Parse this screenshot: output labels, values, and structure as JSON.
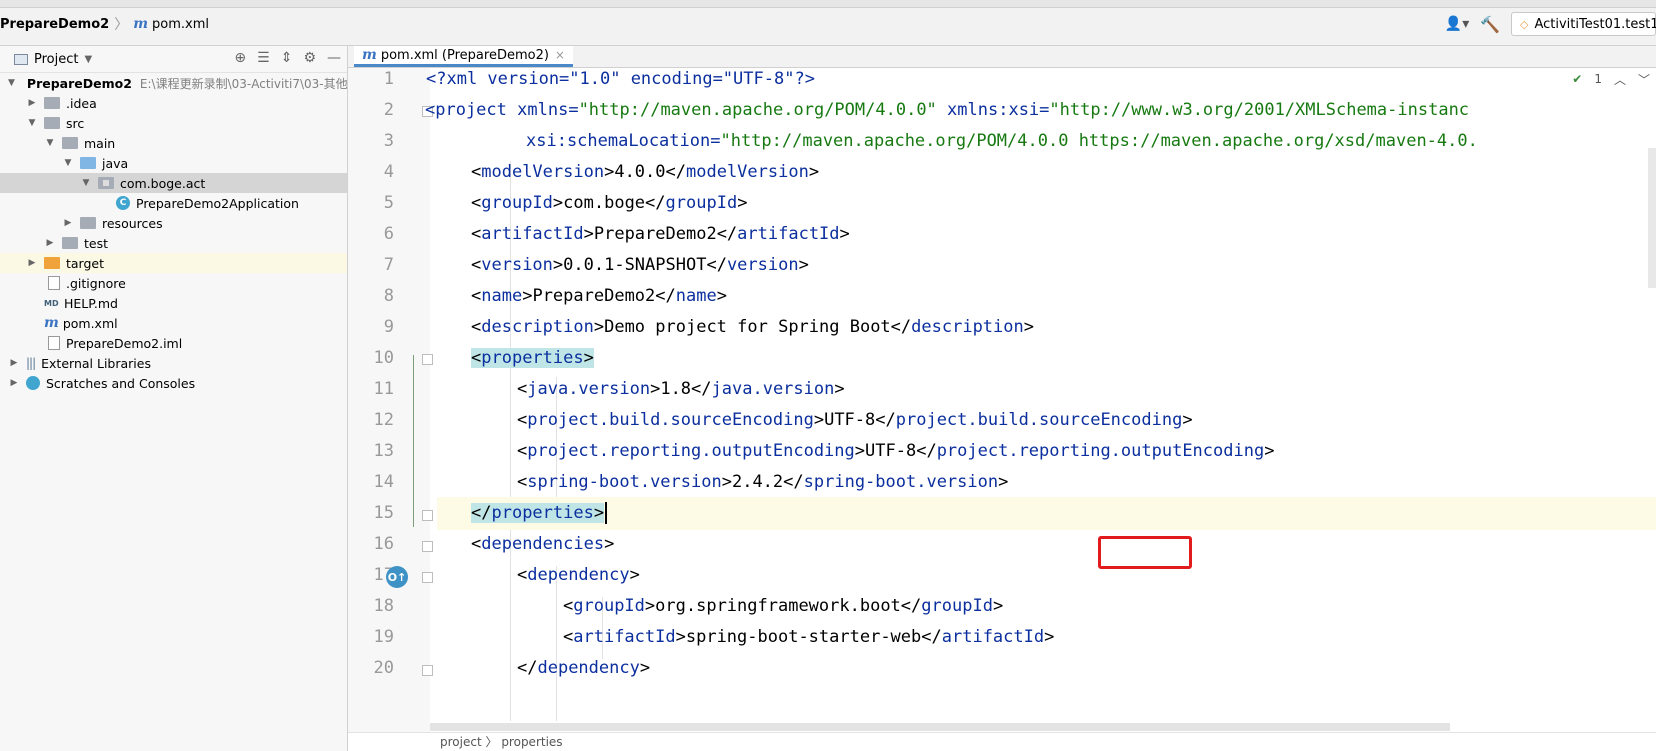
{
  "breadcrumb": {
    "project": "PrepareDemo2",
    "file": "pom.xml"
  },
  "toolbar": {
    "run_config": "ActivitiTest01.test1"
  },
  "project_panel": {
    "title": "Project",
    "root": {
      "name": "PrepareDemo2",
      "path": "E:\\课程更新录制\\03-Activiti7\\03-其他",
      "path_tail": ""
    },
    "items": [
      {
        "label": ".idea"
      },
      {
        "label": "src"
      },
      {
        "label": "main"
      },
      {
        "label": "java"
      },
      {
        "label": "com.boge.act"
      },
      {
        "label": "PrepareDemo2Application"
      },
      {
        "label": "resources"
      },
      {
        "label": "test"
      },
      {
        "label": "target"
      },
      {
        "label": ".gitignore"
      },
      {
        "label": "HELP.md"
      },
      {
        "label": "pom.xml"
      },
      {
        "label": "PrepareDemo2.iml"
      },
      {
        "label": "External Libraries"
      },
      {
        "label": "Scratches and Consoles"
      }
    ]
  },
  "tab": {
    "label": "pom.xml (PrepareDemo2)"
  },
  "inspection": {
    "count": "1"
  },
  "editor": {
    "line_numbers": [
      "1",
      "2",
      "3",
      "4",
      "5",
      "6",
      "7",
      "8",
      "9",
      "10",
      "11",
      "12",
      "13",
      "14",
      "15",
      "16",
      "17",
      "18",
      "19",
      "20"
    ],
    "l1": {
      "decl": "<?xml version=\"1.0\" encoding=\"UTF-8\"?>"
    },
    "l2": {
      "open": "<project",
      "a1": "xmlns=",
      "v1": "\"http://maven.apache.org/POM/4.0.0\"",
      "a2": "xmlns:xsi=",
      "v2": "\"http://www.w3.org/2001/XMLSchema-instanc"
    },
    "l3": {
      "a": "xsi:schemaLocation=",
      "v": "\"http://maven.apache.org/POM/4.0.0 https://maven.apache.org/xsd/maven-4.0."
    },
    "l4": {
      "tag": "modelVersion",
      "text": "4.0.0"
    },
    "l5": {
      "tag": "groupId",
      "text": "com.boge"
    },
    "l6": {
      "tag": "artifactId",
      "text": "PrepareDemo2"
    },
    "l7": {
      "tag": "version",
      "text": "0.0.1-SNAPSHOT"
    },
    "l8": {
      "tag": "name",
      "text": "PrepareDemo2"
    },
    "l9": {
      "tag": "description",
      "text": "Demo project for Spring Boot"
    },
    "l10": {
      "tag": "properties"
    },
    "l11": {
      "tag": "java.version",
      "text": "1.8"
    },
    "l12": {
      "tag": "project.build.sourceEncoding",
      "text": "UTF-8"
    },
    "l13": {
      "tag": "project.reporting.outputEncoding",
      "text": "UTF-8"
    },
    "l14": {
      "tag": "spring-boot.version",
      "text": "2.4.2"
    },
    "l15": {
      "tag": "properties"
    },
    "l16": {
      "tag": "dependencies"
    },
    "l17": {
      "tag": "dependency"
    },
    "l18": {
      "tag": "groupId",
      "text": "org.springframework.boot"
    },
    "l19": {
      "tag": "artifactId",
      "text": "spring-boot-starter-web"
    },
    "l20": {
      "tag": "dependency"
    }
  },
  "bottom_breadcrumb": {
    "a": "project",
    "b": "properties"
  }
}
